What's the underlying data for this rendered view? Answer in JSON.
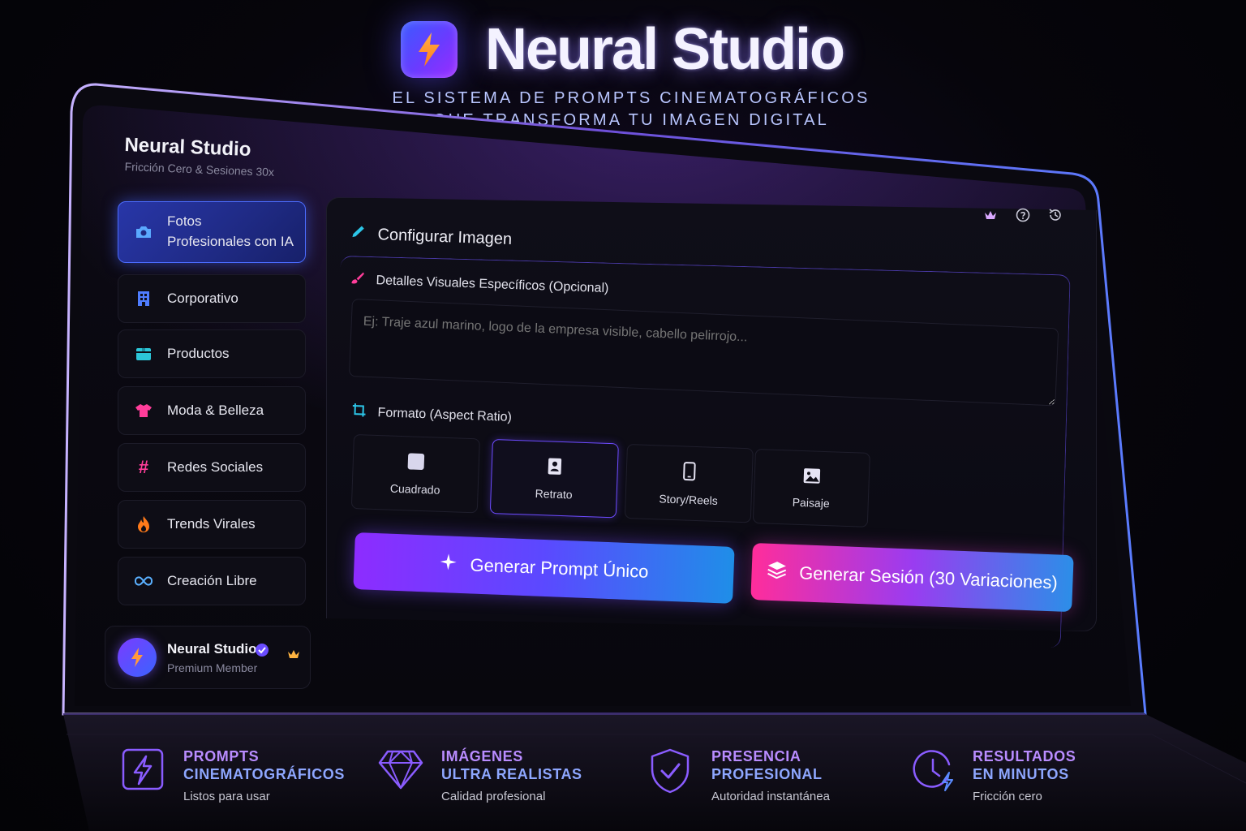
{
  "hero": {
    "title": "Neural Studio",
    "subtitle_line1": "EL SISTEMA DE PROMPTS CINEMATOGRÁFICOS",
    "subtitle_line2": "QUE TRANSFORMA TU IMAGEN DIGITAL"
  },
  "sidebar": {
    "brand": "Neural Studio",
    "tagline": "Fricción Cero & Sesiones 30x",
    "items": [
      {
        "label_line1": "Fotos",
        "label_line2": "Profesionales con IA",
        "icon": "camera-icon",
        "active": true
      },
      {
        "label": "Corporativo",
        "icon": "building-icon"
      },
      {
        "label": "Productos",
        "icon": "box-icon"
      },
      {
        "label": "Moda & Belleza",
        "icon": "shirt-icon"
      },
      {
        "label": "Redes Sociales",
        "icon": "hashtag-icon"
      },
      {
        "label": "Trends Virales",
        "icon": "fire-icon"
      },
      {
        "label": "Creación Libre",
        "icon": "infinity-icon"
      }
    ],
    "profile": {
      "name": "Neural Studio",
      "role": "Premium Member"
    }
  },
  "main": {
    "heading": "Configurar Imagen",
    "details_label": "Detalles Visuales Específicos (Opcional)",
    "details_placeholder": "Ej: Traje azul marino, logo de la empresa visible, cabello pelirrojo...",
    "format_label": "Formato (Aspect Ratio)",
    "formats": [
      {
        "label": "Cuadrado",
        "icon": "square-icon"
      },
      {
        "label": "Retrato",
        "icon": "portrait-icon",
        "selected": true
      },
      {
        "label": "Story/Reels",
        "icon": "phone-icon"
      },
      {
        "label": "Paisaje",
        "icon": "image-icon"
      }
    ],
    "btn_single": "Generar Prompt Único",
    "btn_session": "Generar Sesión (30 Variaciones)"
  },
  "features": [
    {
      "title1": "PROMPTS",
      "title2": "CINEMATOGRÁFICOS",
      "desc": "Listos para usar",
      "icon": "bolt-icon"
    },
    {
      "title1": "IMÁGENES",
      "title2": "ULTRA REALISTAS",
      "desc": "Calidad profesional",
      "icon": "diamond-icon"
    },
    {
      "title1": "PRESENCIA",
      "title2": "PROFESIONAL",
      "desc": "Autoridad instantánea",
      "icon": "shield-check-icon"
    },
    {
      "title1": "RESULTADOS",
      "title2": "EN MINUTOS",
      "desc": "Fricción cero",
      "icon": "clock-bolt-icon"
    }
  ],
  "colors": {
    "accent_purple": "#8d2cff",
    "accent_blue": "#1f8ee8",
    "accent_pink": "#ff2d9b",
    "feature_title_1": "#b98cff",
    "feature_title_2": "#8ea7ff"
  }
}
